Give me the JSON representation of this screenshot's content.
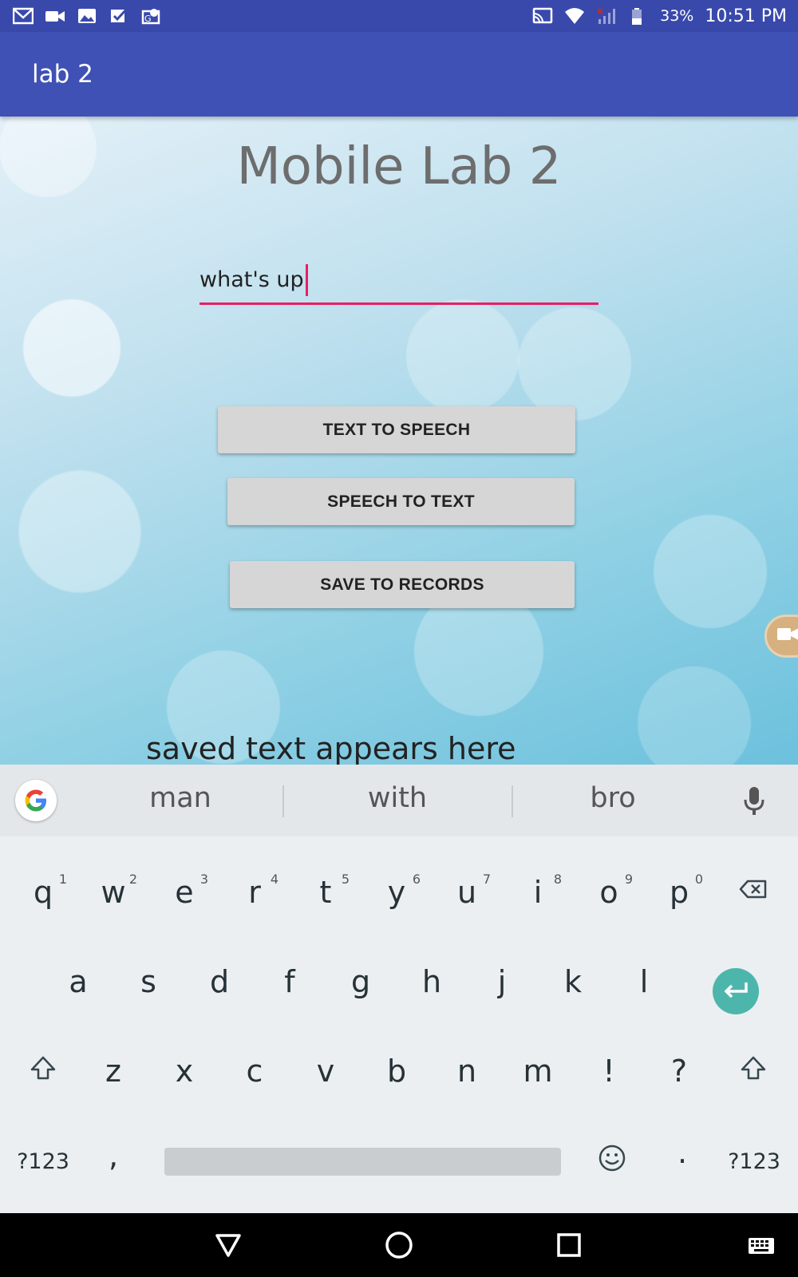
{
  "status_bar": {
    "left_icons": [
      "gmail-icon",
      "video-camera-icon",
      "gallery-icon",
      "tasks-icon",
      "maps-icon"
    ],
    "right_icons": [
      "cast-icon",
      "wifi-icon",
      "signal-icon",
      "battery-icon"
    ],
    "battery": "33%",
    "time": "10:51 PM"
  },
  "app_bar": {
    "title": "lab 2"
  },
  "main": {
    "heading": "Mobile Lab 2",
    "input_value": "what's up",
    "buttons": {
      "text_to_speech": "TEXT TO SPEECH",
      "speech_to_text": "SPEECH TO TEXT",
      "save_to_records": "SAVE TO RECORDS"
    },
    "saved_text": "saved text appears here"
  },
  "keyboard": {
    "suggestions": [
      "man",
      "with",
      "bro"
    ],
    "row1": [
      {
        "key": "q",
        "hint": "1"
      },
      {
        "key": "w",
        "hint": "2"
      },
      {
        "key": "e",
        "hint": "3"
      },
      {
        "key": "r",
        "hint": "4"
      },
      {
        "key": "t",
        "hint": "5"
      },
      {
        "key": "y",
        "hint": "6"
      },
      {
        "key": "u",
        "hint": "7"
      },
      {
        "key": "i",
        "hint": "8"
      },
      {
        "key": "o",
        "hint": "9"
      },
      {
        "key": "p",
        "hint": "0"
      }
    ],
    "row2": [
      "a",
      "s",
      "d",
      "f",
      "g",
      "h",
      "j",
      "k",
      "l"
    ],
    "row3": [
      "z",
      "x",
      "c",
      "v",
      "b",
      "n",
      "m",
      "!",
      "?"
    ],
    "symbols_label": "?123",
    "comma": ",",
    "period": "·",
    "symbols_label_right": "?123"
  },
  "colors": {
    "app_bar": "#3f51b5",
    "status_bar": "#3949ab",
    "input_underline": "#e91e63",
    "enter_key": "#4db6ac"
  }
}
